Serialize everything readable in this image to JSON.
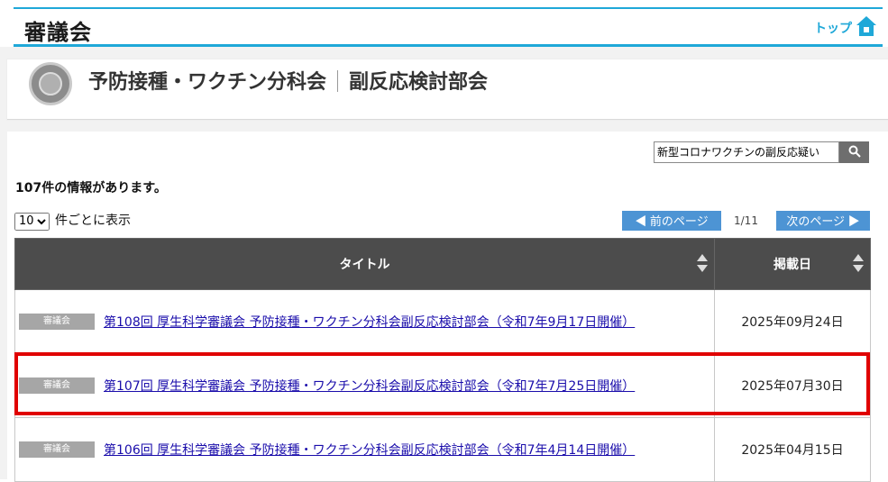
{
  "header": {
    "site_title": "審議会",
    "top_label": "トップ"
  },
  "panel": {
    "title_main": "予防接種・ワクチン分科会",
    "title_sub": "副反応検討部会"
  },
  "search": {
    "value": "新型コロナワクチンの副反応疑い"
  },
  "results": {
    "count_text": "107件の情報があります。",
    "perpage_value": "10",
    "perpage_suffix": "件ごとに表示",
    "prev_label": "◀ 前のページ",
    "next_label": "次のページ ▶",
    "page_indicator": "1/11"
  },
  "table": {
    "col_title": "タイトル",
    "col_date": "掲載日",
    "rows": [
      {
        "badge": "審議会",
        "title": "第108回 厚生科学審議会 予防接種・ワクチン分科会副反応検討部会（令和7年9月17日開催）",
        "date": "2025年09月24日"
      },
      {
        "badge": "審議会",
        "title": "第107回 厚生科学審議会 予防接種・ワクチン分科会副反応検討部会（令和7年7月25日開催）",
        "date": "2025年07月30日"
      },
      {
        "badge": "審議会",
        "title": "第106回 厚生科学審議会 予防接種・ワクチン分科会副反応検討部会（令和7年4月14日開催）",
        "date": "2025年04月15日"
      }
    ]
  },
  "colors": {
    "accent": "#1fa8d8",
    "button": "#4d94d4",
    "table_header": "#4c4c4c",
    "highlight": "#e00000"
  }
}
